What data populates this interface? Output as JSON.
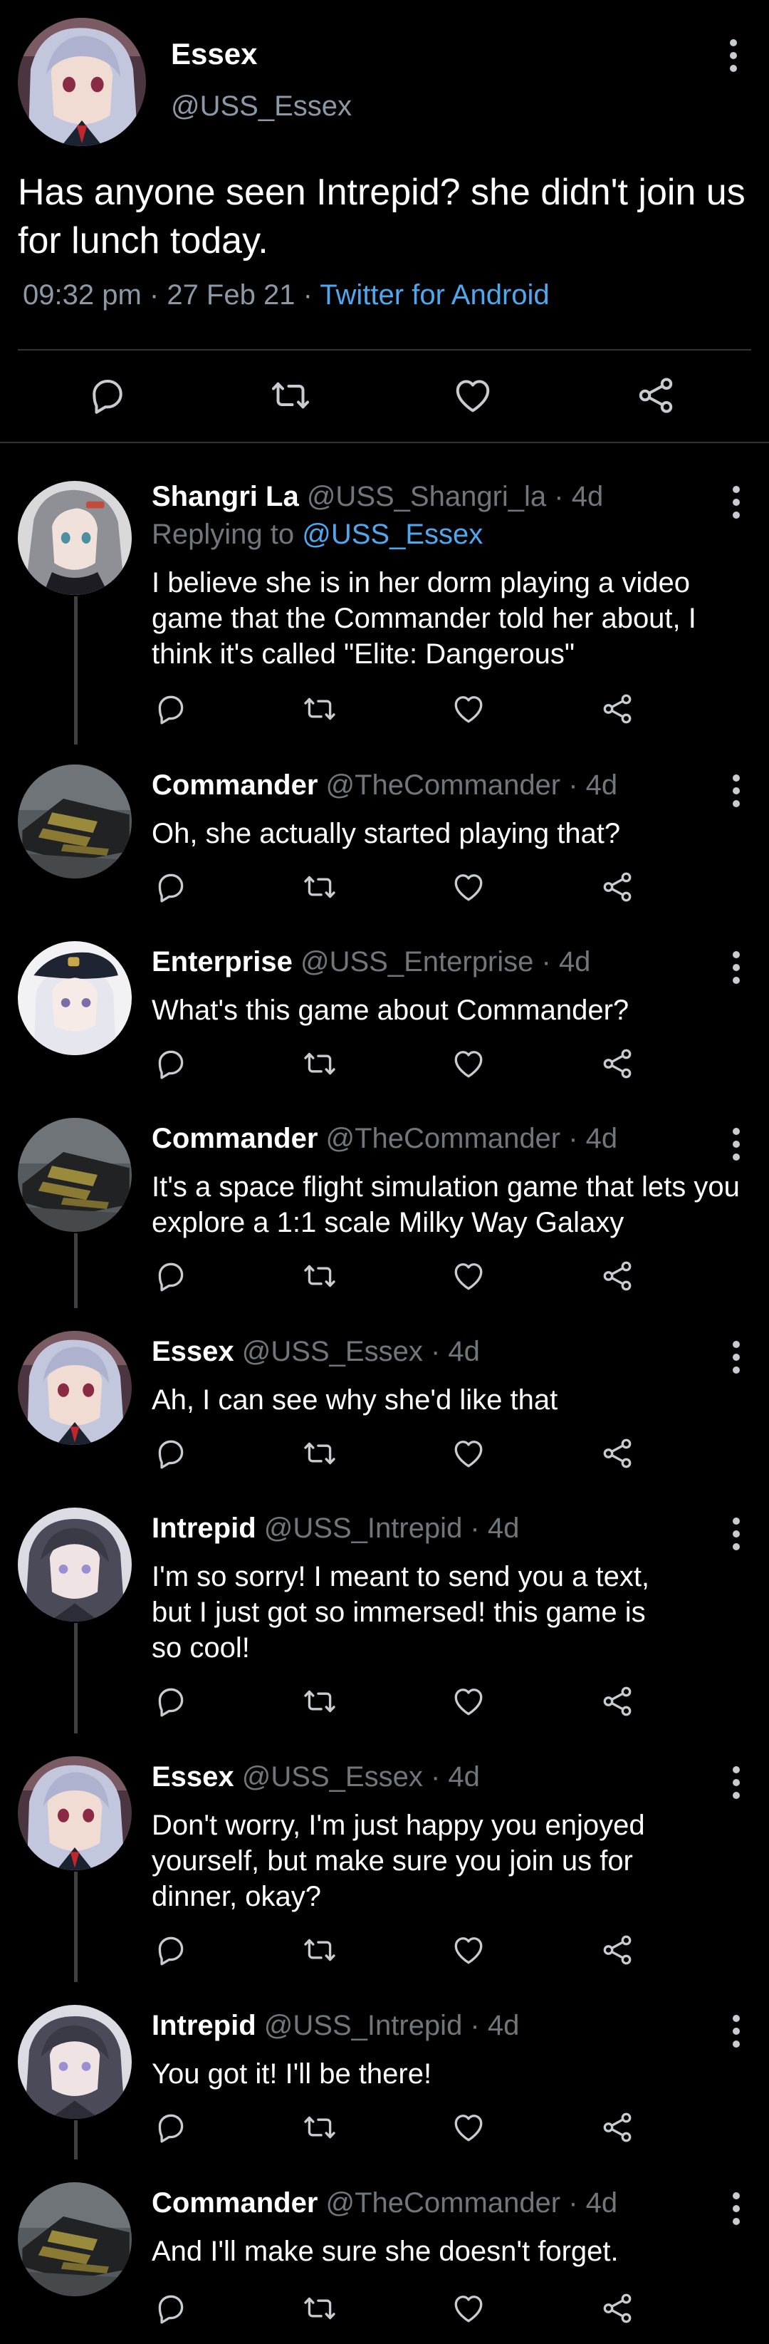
{
  "main": {
    "author_name": "Essex",
    "author_handle": "@USS_Essex",
    "text": "Has anyone seen Intrepid? she didn't join us for lunch today.",
    "time": "09:32 pm",
    "date": "27 Feb 21",
    "source": "Twitter for Android",
    "avatar": "essex-avatar"
  },
  "icons": {
    "reply": "reply-icon",
    "retweet": "retweet-icon",
    "like": "heart-icon",
    "share": "share-icon",
    "more": "more-vertical-icon"
  },
  "colors": {
    "background": "#000000",
    "link": "#4ea7ef",
    "muted": "#71767b",
    "divider": "#2f3336"
  },
  "replies": [
    {
      "name": "Shangri La",
      "handle": "@USS_Shangri_la",
      "age": "4d",
      "replying_label": "Replying to",
      "replying_to": "@USS_Essex",
      "text": "I believe she is in her dorm playing a video game that the Commander told her about, I think it's called \"Elite: Dangerous\"",
      "avatar": "shangri-la-avatar"
    },
    {
      "name": "Commander",
      "handle": "@TheCommander",
      "age": "4d",
      "text": "Oh, she actually started playing that?",
      "avatar": "commander-avatar"
    },
    {
      "name": "Enterprise",
      "handle": "@USS_Enterprise",
      "age": "4d",
      "text": "What's this game about Commander?",
      "avatar": "enterprise-avatar"
    },
    {
      "name": "Commander",
      "handle": "@TheCommander",
      "age": "4d",
      "text": "It's a space flight simulation game that lets you explore a 1:1 scale Milky Way Galaxy",
      "avatar": "commander-avatar"
    },
    {
      "name": "Essex",
      "handle": "@USS_Essex",
      "age": "4d",
      "text": "Ah, I can see why she'd like that",
      "avatar": "essex-avatar"
    },
    {
      "name": "Intrepid",
      "handle": "@USS_Intrepid",
      "age": "4d",
      "text": "I'm so sorry! I meant to send you a text, but I just got so immersed! this game is so cool!",
      "avatar": "intrepid-avatar"
    },
    {
      "name": "Essex",
      "handle": "@USS_Essex",
      "age": "4d",
      "text": "Don't worry, I'm just happy you enjoyed yourself, but make sure you join us for dinner, okay?",
      "avatar": "essex-avatar"
    },
    {
      "name": "Intrepid",
      "handle": "@USS_Intrepid",
      "age": "4d",
      "text": "You got it! I'll be there!",
      "avatar": "intrepid-avatar"
    },
    {
      "name": "Commander",
      "handle": "@TheCommander",
      "age": "4d",
      "text": "And I'll make sure she doesn't forget.",
      "avatar": "commander-avatar"
    }
  ]
}
